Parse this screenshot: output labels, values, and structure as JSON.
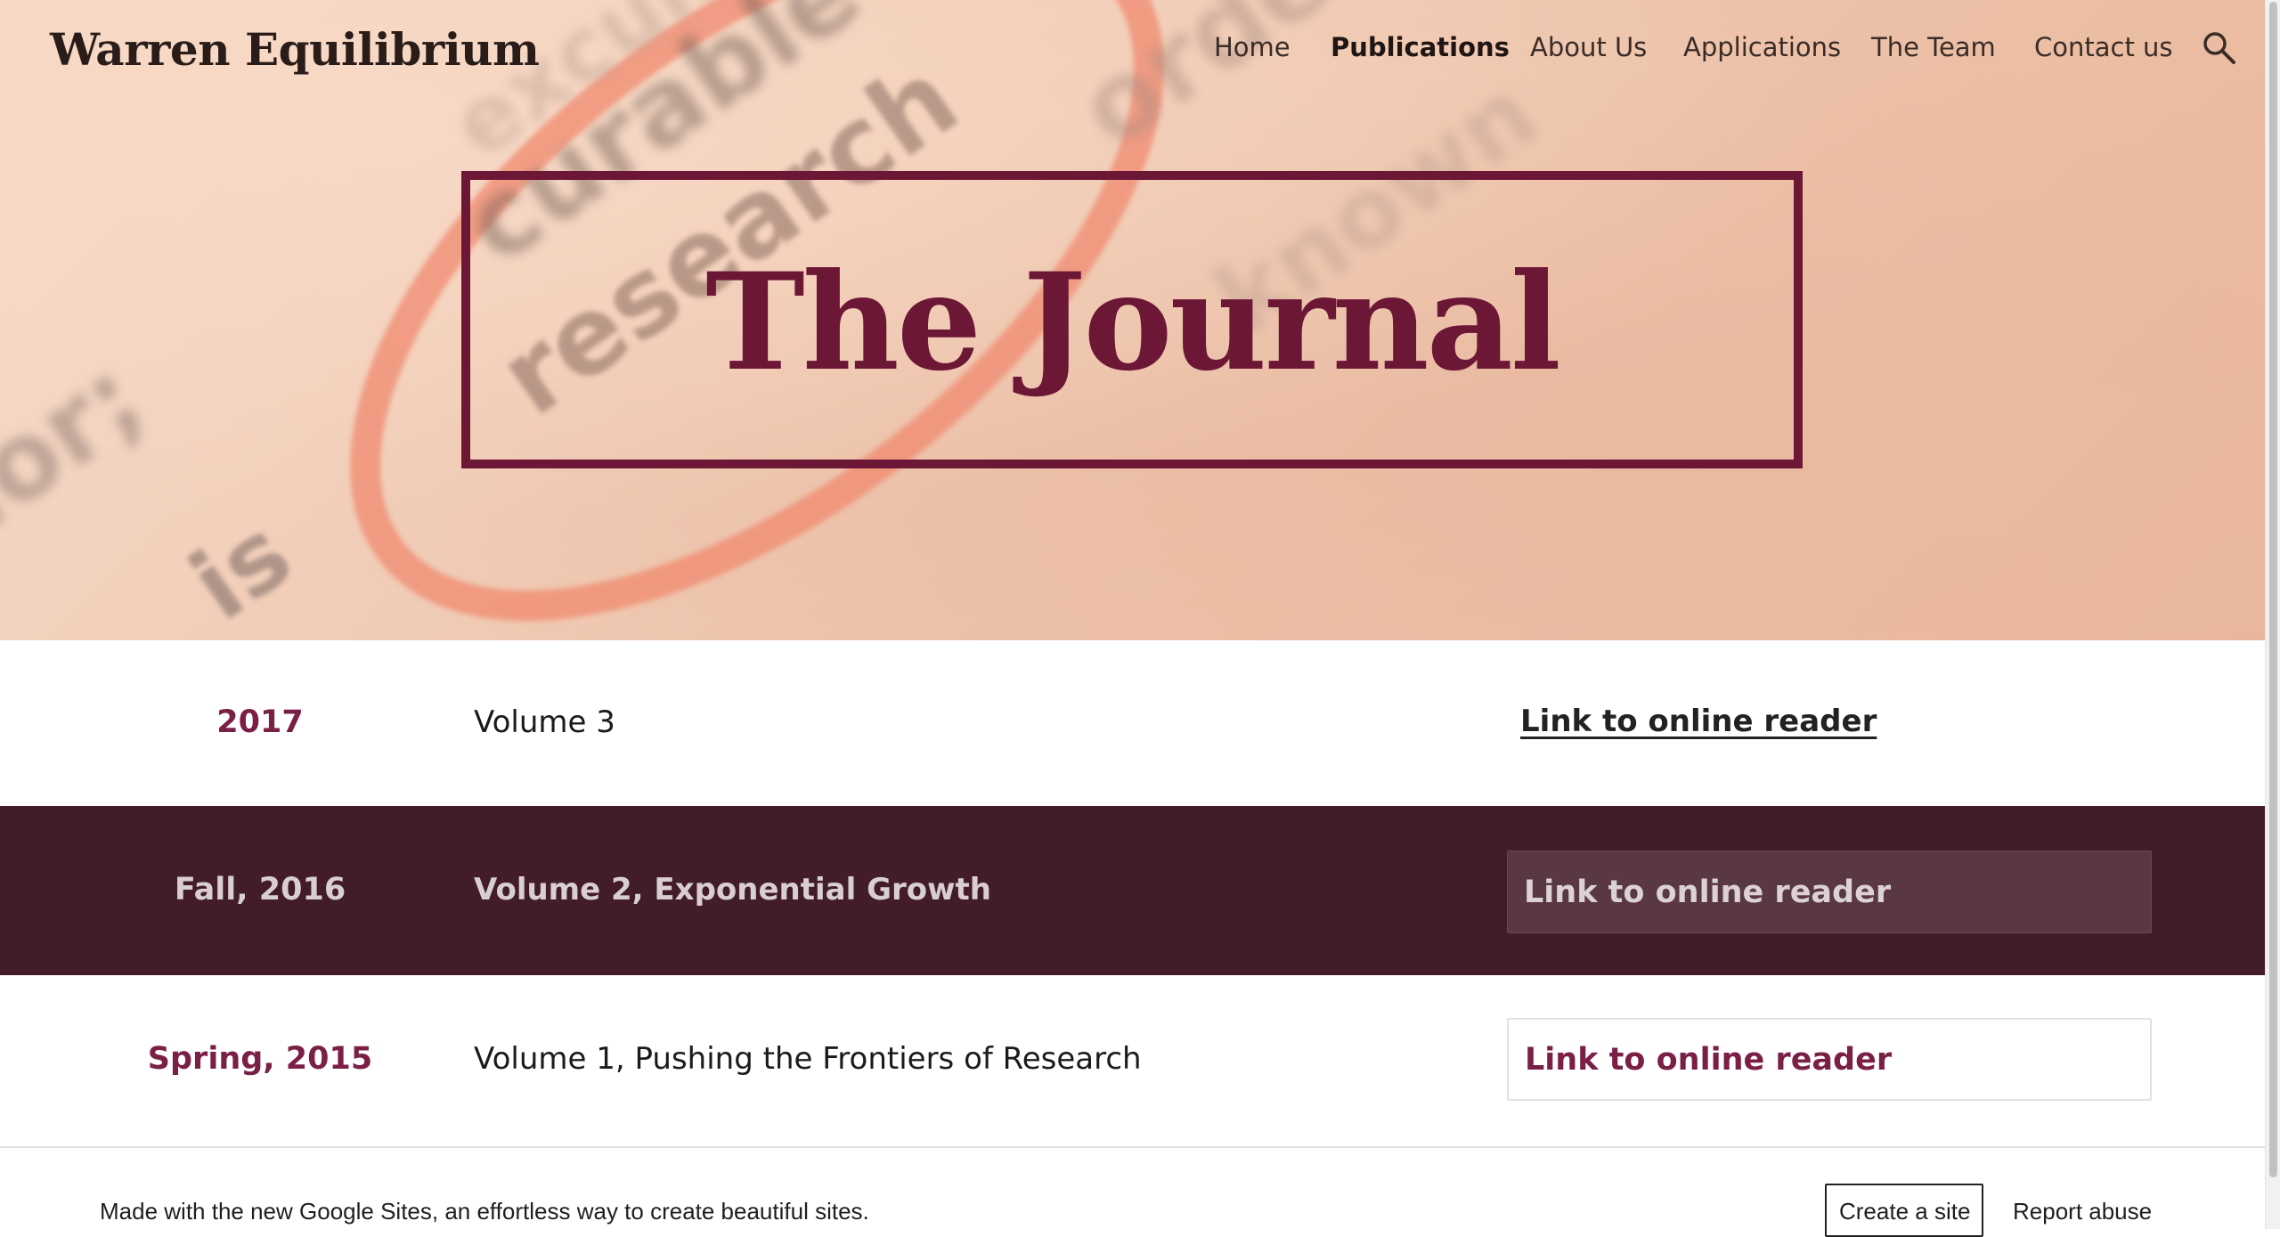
{
  "site": {
    "title": "Warren Equilibrium"
  },
  "nav": {
    "items": [
      {
        "label": "Home",
        "active": false
      },
      {
        "label": "Publications",
        "active": true
      },
      {
        "label": "About Us",
        "active": false
      },
      {
        "label": "Applications",
        "active": false
      },
      {
        "label": "The Team",
        "active": false
      },
      {
        "label": "Contact us",
        "active": false
      }
    ],
    "search_icon": "search-icon"
  },
  "hero": {
    "title": "The Journal",
    "background_words": [
      "research",
      "curable",
      "order",
      "known",
      "is",
      "ior;",
      "exculo"
    ]
  },
  "volumes": [
    {
      "date": "2017",
      "name": "Volume 3",
      "link_label": "Link to online reader"
    },
    {
      "date": "Fall, 2016",
      "name": "Volume 2, Exponential Growth",
      "link_label": "Link to online reader"
    },
    {
      "date": "Spring, 2015",
      "name": "Volume 1, Pushing the Frontiers of Research",
      "link_label": "Link to online reader"
    }
  ],
  "footer": {
    "text": "Made with the new Google Sites, an effortless way to create beautiful sites.",
    "create_site_label": "Create a site",
    "report_abuse_label": "Report abuse"
  },
  "colors": {
    "accent": "#6d1737",
    "dark_band": "#421c2a",
    "date_accent": "#7a1f45"
  }
}
